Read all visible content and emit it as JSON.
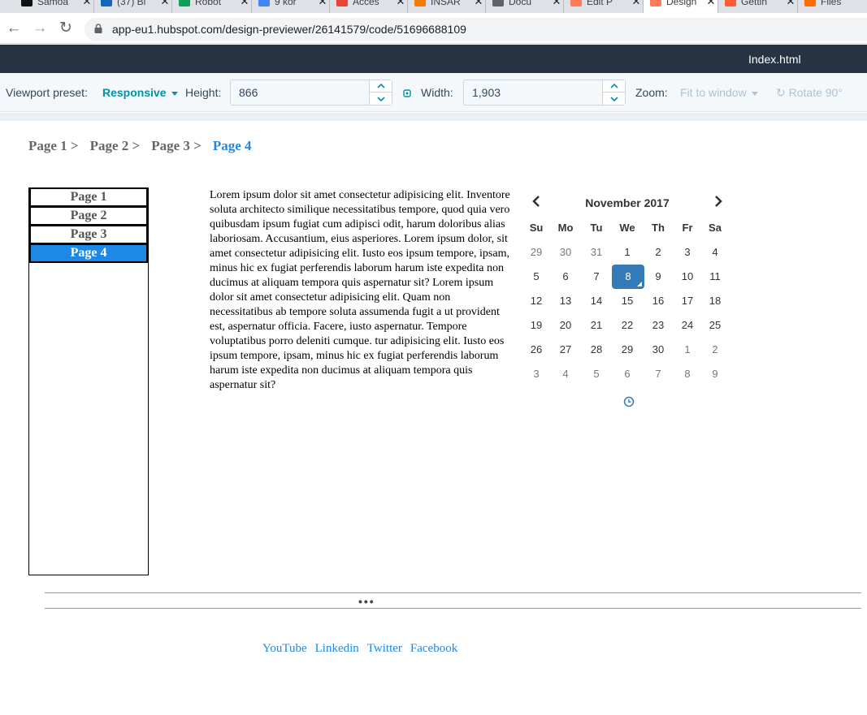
{
  "browser": {
    "tabs": [
      {
        "title": "Samoa",
        "color": "#111111"
      },
      {
        "title": "(37) Bi",
        "color": "#1565c0"
      },
      {
        "title": "Robot",
        "color": "#0f9d58"
      },
      {
        "title": "9 kor",
        "color": "#4285f4"
      },
      {
        "title": "Acces",
        "color": "#ea4335"
      },
      {
        "title": "INSAR",
        "color": "#f57c00"
      },
      {
        "title": "Docu",
        "color": "#5f6368"
      },
      {
        "title": "Edit P",
        "color": "#ff7a59"
      },
      {
        "title": "Design",
        "color": "#ff7a59"
      },
      {
        "title": "Gettin",
        "color": "#ff5c35"
      },
      {
        "title": "Files",
        "color": "#ff6d00"
      }
    ],
    "url": "app-eu1.hubspot.com/design-previewer/26141579/code/51696688109"
  },
  "header": {
    "file_name": "Index.html"
  },
  "toolbar": {
    "viewport_label": "Viewport preset:",
    "viewport_value": "Responsive",
    "height_label": "Height:",
    "height_value": "866",
    "width_label": "Width:",
    "width_value": "1,903",
    "zoom_label": "Zoom:",
    "zoom_value": "Fit to window",
    "rotate_label": "Rotate 90°"
  },
  "preview": {
    "breadcrumb": [
      {
        "label": "Page 1 >"
      },
      {
        "label": "Page 2 >"
      },
      {
        "label": "Page 3 >"
      },
      {
        "label": "Page 4"
      }
    ],
    "sidenav": [
      "Page 1",
      "Page 2",
      "Page 3",
      "Page 4"
    ],
    "selected_page": "Page 4",
    "lorem": "Lorem ipsum dolor sit amet consectetur adipisicing elit. Inventore soluta architecto similique necessitatibus tempore, quod quia vero quibusdam ipsum fugiat cum adipisci odit, harum doloribus alias laboriosam. Accusantium, eius asperiores. Lorem ipsum dolor, sit amet consectetur adipisicing elit. Iusto eos ipsum tempore, ipsam, minus hic ex fugiat perferendis laborum harum iste expedita non ducimus at aliquam tempora quis aspernatur sit? Lorem ipsum dolor sit amet consectetur adipisicing elit. Quam non necessitatibus ab tempore soluta assumenda fugit a ut provident est, aspernatur officia. Facere, iusto aspernatur. Tempore voluptatibus porro deleniti cumque. tur adipisicing elit. Iusto eos ipsum tempore, ipsam, minus hic ex fugiat perferendis laborum harum iste expedita non ducimus at aliquam tempora quis aspernatur sit?",
    "calendar": {
      "month": "November 2017",
      "weekdays": [
        "Su",
        "Mo",
        "Tu",
        "We",
        "Th",
        "Fr",
        "Sa"
      ],
      "selected_day": "8",
      "weeks": [
        [
          {
            "d": "29",
            "m": true
          },
          {
            "d": "30",
            "m": true
          },
          {
            "d": "31",
            "m": true
          },
          {
            "d": "1"
          },
          {
            "d": "2"
          },
          {
            "d": "3"
          },
          {
            "d": "4"
          }
        ],
        [
          {
            "d": "5"
          },
          {
            "d": "6"
          },
          {
            "d": "7"
          },
          {
            "d": "8",
            "s": true
          },
          {
            "d": "9"
          },
          {
            "d": "10"
          },
          {
            "d": "11"
          }
        ],
        [
          {
            "d": "12"
          },
          {
            "d": "13"
          },
          {
            "d": "14"
          },
          {
            "d": "15"
          },
          {
            "d": "16"
          },
          {
            "d": "17"
          },
          {
            "d": "18"
          }
        ],
        [
          {
            "d": "19"
          },
          {
            "d": "20"
          },
          {
            "d": "21"
          },
          {
            "d": "22"
          },
          {
            "d": "23"
          },
          {
            "d": "24"
          },
          {
            "d": "25"
          }
        ],
        [
          {
            "d": "26"
          },
          {
            "d": "27"
          },
          {
            "d": "28"
          },
          {
            "d": "29"
          },
          {
            "d": "30"
          },
          {
            "d": "1",
            "m": true
          },
          {
            "d": "2",
            "m": true
          }
        ],
        [
          {
            "d": "3",
            "m": true
          },
          {
            "d": "4",
            "m": true
          },
          {
            "d": "5",
            "m": true
          },
          {
            "d": "6",
            "m": true
          },
          {
            "d": "7",
            "m": true
          },
          {
            "d": "8",
            "m": true
          },
          {
            "d": "9",
            "m": true
          }
        ]
      ]
    },
    "ellipsis": "•••",
    "footer_links": [
      "YouTube",
      "Linkedin",
      "Twitter",
      "Facebook"
    ]
  },
  "colors": {
    "hubspot_header": "#253342",
    "link_blue": "#1e88e5",
    "calendar_selected": "#337ab7",
    "teal_link": "#0091ae"
  }
}
